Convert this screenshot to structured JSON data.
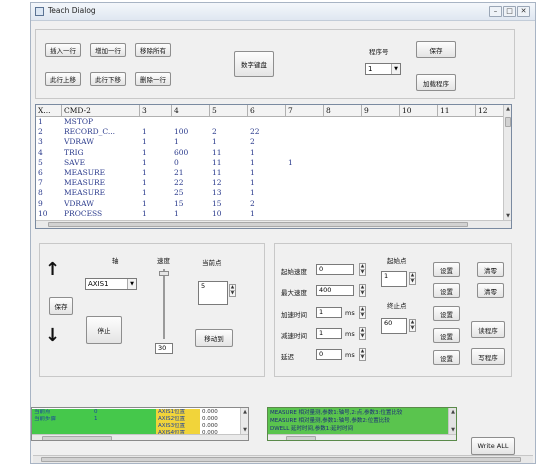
{
  "window": {
    "title": "Teach Dialog",
    "minimize": "–",
    "maximize": "□",
    "close": "✕"
  },
  "toolbar": {
    "insert_row": "插入一行",
    "add_row": "增加一行",
    "move_all": "移除所有",
    "move_up": "此行上移",
    "move_down": "此行下移",
    "delete_row": "删除一行",
    "numeric_keyboard": "数字键盘",
    "program_no_label": "程序号",
    "program_no_value": "1",
    "save": "保存",
    "load_program": "加载程序"
  },
  "table": {
    "headers": [
      "X...",
      "CMD-2",
      "3",
      "4",
      "5",
      "6",
      "7",
      "8",
      "9",
      "10",
      "11",
      "12"
    ],
    "rows": [
      [
        "1",
        "MSTOP",
        "",
        "",
        "",
        "",
        ""
      ],
      [
        "2",
        "RECORD_C...",
        "1",
        "100",
        "2",
        "22",
        ""
      ],
      [
        "3",
        "VDRAW",
        "1",
        "1",
        "1",
        "2",
        ""
      ],
      [
        "4",
        "TRIG",
        "1",
        "600",
        "11",
        "1",
        ""
      ],
      [
        "5",
        "SAVE",
        "1",
        "0",
        "11",
        "1",
        "1"
      ],
      [
        "6",
        "MEASURE",
        "1",
        "21",
        "11",
        "1",
        ""
      ],
      [
        "7",
        "MEASURE",
        "1",
        "22",
        "12",
        "1",
        ""
      ],
      [
        "8",
        "MEASURE",
        "1",
        "25",
        "13",
        "1",
        ""
      ],
      [
        "9",
        "VDRAW",
        "1",
        "15",
        "15",
        "2",
        ""
      ],
      [
        "10",
        "PROCESS",
        "1",
        "1",
        "10",
        "1",
        ""
      ]
    ]
  },
  "jog": {
    "axis_label": "轴",
    "axis_value": "AXIS1",
    "save": "保存",
    "stop": "停止",
    "speed_label": "速度",
    "speed_value": "30",
    "current_point_label": "当前点",
    "current_point_value": "5",
    "move_to": "移动到",
    "up_arrow": "↑",
    "down_arrow": "↓"
  },
  "params": {
    "start_speed_label": "起始速度",
    "start_speed_value": "0",
    "max_speed_label": "最大速度",
    "max_speed_value": "400",
    "accel_time_label": "加速时间",
    "accel_time_value": "1",
    "decel_time_label": "减速时间",
    "decel_time_value": "1",
    "delay_label": "延迟",
    "delay_value": "0",
    "unit_ms": "ms",
    "start_point_label": "起始点",
    "start_point_value": "1",
    "end_point_label": "终止点",
    "end_point_value": "60",
    "set_label": "设置",
    "clear_label": "清零",
    "read_program": "读程序",
    "write_program": "写程序"
  },
  "status_table": {
    "rows": [
      {
        "name": "当前点",
        "value": "0",
        "axis": "AXIS1位置",
        "pos": "0.000"
      },
      {
        "name": "当前步骤",
        "value": "1",
        "axis": "AXIS2位置",
        "pos": "0.000"
      },
      {
        "name": "",
        "value": "",
        "axis": "AXIS3位置",
        "pos": "0.000"
      },
      {
        "name": "",
        "value": "",
        "axis": "AXIS4位置",
        "pos": "0.000"
      }
    ]
  },
  "log": {
    "lines": [
      "MEASURE 相对量测,参数1:轴号,2:点,参数3:位置比较",
      "MEASURE 相对量测,参数1:轴号,参数2:位置比较",
      "DWELL 延时时间,参数1:延时时间"
    ]
  },
  "write_all": "Write ALL",
  "colors": {
    "status_green": "#45c84b",
    "status_yellow": "#f1d43a",
    "log_green": "#5ac44e",
    "grid_text": "#2a3a8c"
  }
}
